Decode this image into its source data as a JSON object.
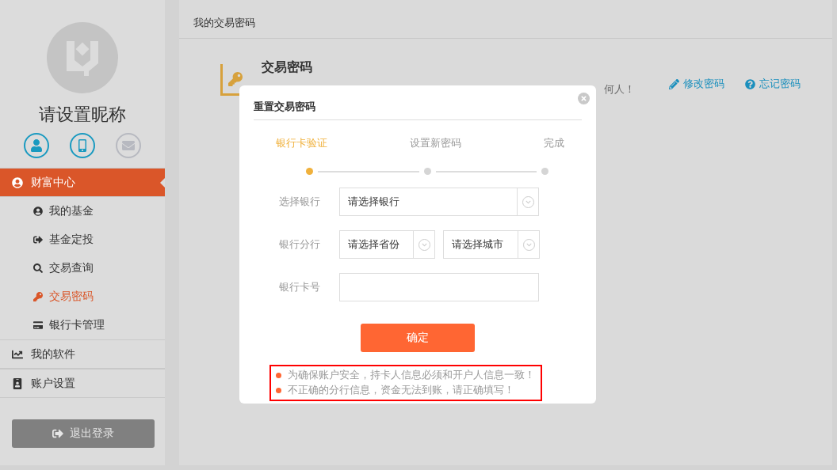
{
  "sidebar": {
    "nickname": "请设置昵称",
    "contacts": [
      {
        "kind": "user",
        "verified": true
      },
      {
        "kind": "phone",
        "verified": true
      },
      {
        "kind": "mail",
        "verified": false
      }
    ],
    "menu": [
      {
        "label": "财富中心",
        "selected": true,
        "children": [
          {
            "label": "我的基金",
            "selected": false
          },
          {
            "label": "基金定投",
            "selected": false
          },
          {
            "label": "交易查询",
            "selected": false
          },
          {
            "label": "交易密码",
            "selected": true
          },
          {
            "label": "银行卡管理",
            "selected": false
          }
        ]
      },
      {
        "label": "我的软件",
        "selected": false
      },
      {
        "label": "账户设置",
        "selected": false
      }
    ],
    "logout": "退出登录"
  },
  "main": {
    "breadcrumb": "我的交易密码",
    "card": {
      "title": "交易密码",
      "description": "何人！",
      "actions": [
        {
          "label": "修改密码",
          "kind": "edit"
        },
        {
          "label": "忘记密码",
          "kind": "help"
        }
      ]
    }
  },
  "modal": {
    "title": "重置交易密码",
    "steps": [
      {
        "label": "银行卡验证",
        "selected": true
      },
      {
        "label": "设置新密码",
        "selected": false
      },
      {
        "label": "完成",
        "selected": false
      }
    ],
    "fields": [
      {
        "label": "选择银行",
        "kind": "select",
        "selects": [
          {
            "placeholder": "请选择银行"
          }
        ]
      },
      {
        "label": "银行分行",
        "kind": "select",
        "selects": [
          {
            "placeholder": "请选择省份"
          },
          {
            "placeholder": "请选择城市"
          }
        ]
      },
      {
        "label": "银行卡号",
        "kind": "input"
      }
    ],
    "submit": "确定",
    "notes": [
      "为确保账户安全，持卡人信息必须和开户人信息一致！",
      "不正确的分行信息，资金无法到账，请正确填写！"
    ]
  }
}
